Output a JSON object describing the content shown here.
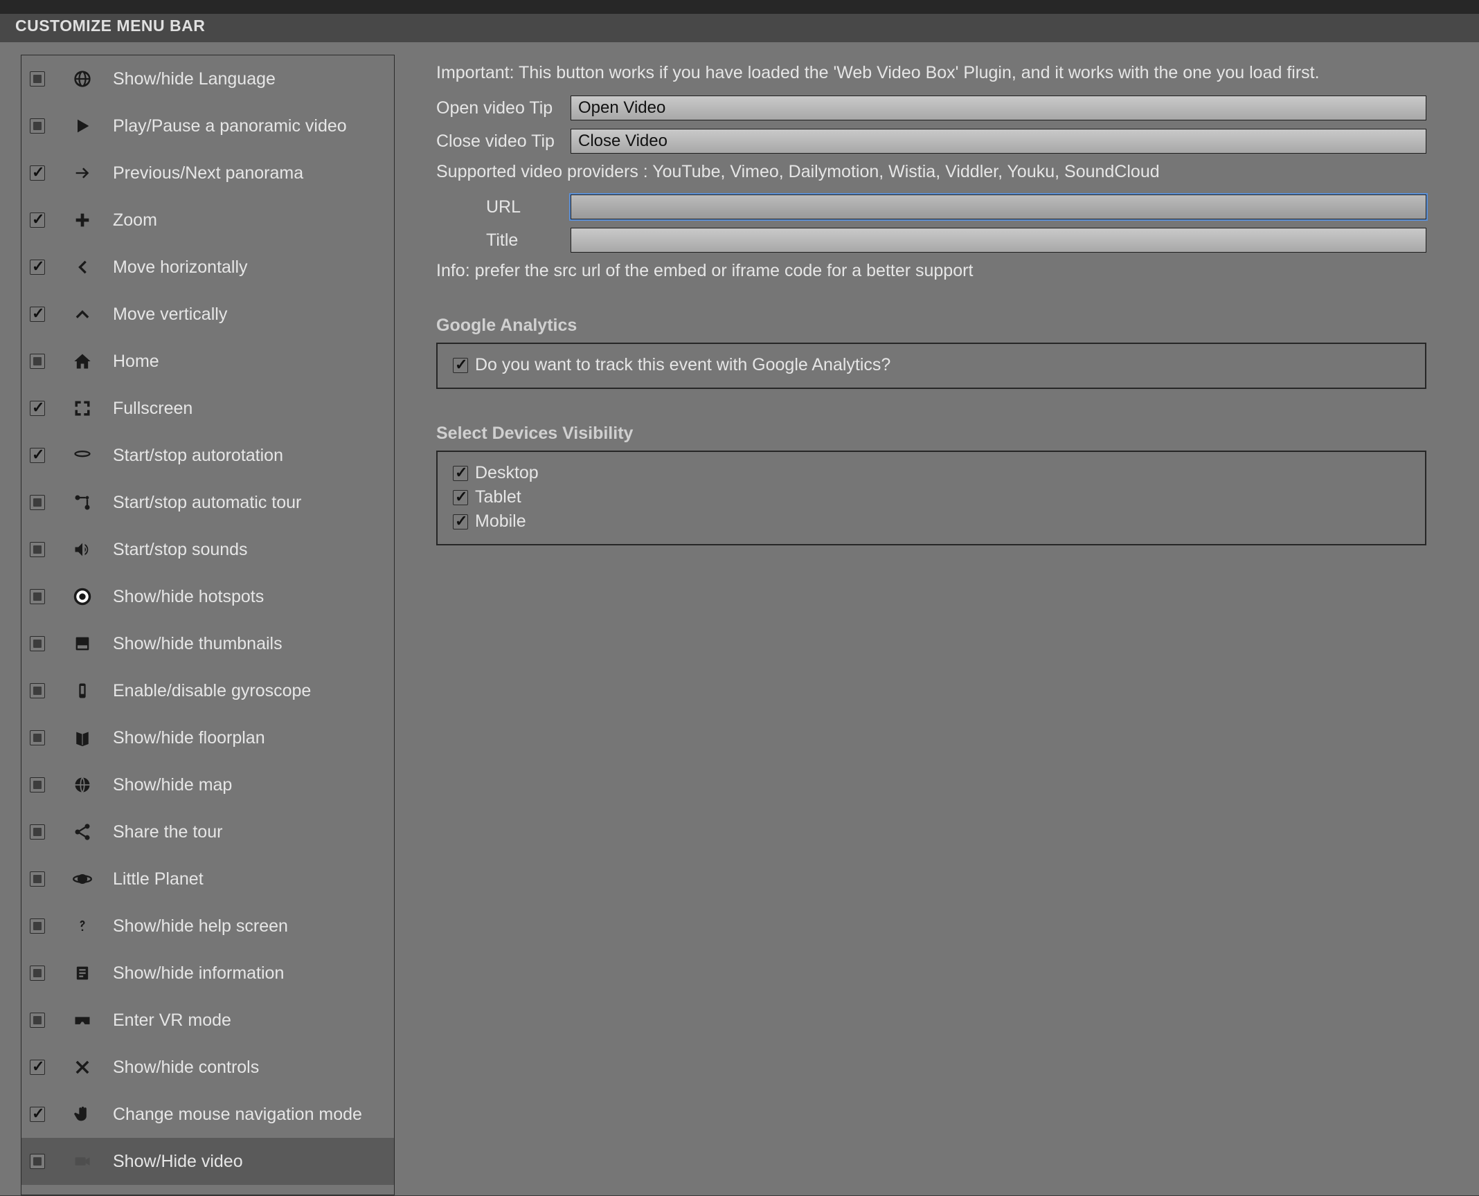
{
  "header": {
    "title": "CUSTOMIZE MENU BAR"
  },
  "sidebar": {
    "items": [
      {
        "checked": false,
        "icon": "globe",
        "label": "Show/hide Language"
      },
      {
        "checked": false,
        "icon": "play",
        "label": "Play/Pause a panoramic video"
      },
      {
        "checked": true,
        "icon": "arrow-right",
        "label": "Previous/Next panorama"
      },
      {
        "checked": true,
        "icon": "plus",
        "label": "Zoom"
      },
      {
        "checked": true,
        "icon": "chevron-left",
        "label": "Move horizontally"
      },
      {
        "checked": true,
        "icon": "chevron-up",
        "label": "Move vertically"
      },
      {
        "checked": false,
        "icon": "home",
        "label": "Home"
      },
      {
        "checked": true,
        "icon": "fullscreen",
        "label": "Fullscreen"
      },
      {
        "checked": true,
        "icon": "rotate",
        "label": "Start/stop autorotation"
      },
      {
        "checked": false,
        "icon": "route",
        "label": "Start/stop automatic tour"
      },
      {
        "checked": false,
        "icon": "sound",
        "label": "Start/stop sounds"
      },
      {
        "checked": false,
        "icon": "hotspot",
        "label": "Show/hide hotspots"
      },
      {
        "checked": false,
        "icon": "thumbnails",
        "label": "Show/hide thumbnails"
      },
      {
        "checked": false,
        "icon": "gyroscope",
        "label": "Enable/disable gyroscope"
      },
      {
        "checked": false,
        "icon": "floorplan",
        "label": "Show/hide floorplan"
      },
      {
        "checked": false,
        "icon": "map-globe",
        "label": "Show/hide map"
      },
      {
        "checked": false,
        "icon": "share",
        "label": "Share the tour"
      },
      {
        "checked": false,
        "icon": "planet",
        "label": "Little Planet"
      },
      {
        "checked": false,
        "icon": "help",
        "label": "Show/hide help screen"
      },
      {
        "checked": false,
        "icon": "info",
        "label": "Show/hide information"
      },
      {
        "checked": false,
        "icon": "vr",
        "label": "Enter VR mode"
      },
      {
        "checked": true,
        "icon": "close",
        "label": "Show/hide controls"
      },
      {
        "checked": true,
        "icon": "hand",
        "label": "Change mouse navigation mode"
      },
      {
        "checked": false,
        "icon": "video",
        "label": "Show/Hide video",
        "selected": true
      }
    ]
  },
  "main": {
    "important": "Important: This button works if you have loaded the 'Web Video Box' Plugin, and it works with the one you load first.",
    "open_tip_label": "Open video Tip",
    "open_tip_value": "Open Video",
    "close_tip_label": "Close video Tip",
    "close_tip_value": "Close Video",
    "providers": "Supported video providers : YouTube, Vimeo, Dailymotion, Wistia, Viddler, Youku, SoundCloud",
    "url_label": "URL",
    "url_value": "",
    "title_label": "Title",
    "title_value": "",
    "info": "Info: prefer the src url of the embed or iframe code for a better support",
    "analytics": {
      "heading": "Google Analytics",
      "track_label": "Do you want to track this event with Google Analytics?",
      "track_checked": true
    },
    "devices": {
      "heading": "Select Devices Visibility",
      "desktop_label": "Desktop",
      "desktop_checked": true,
      "tablet_label": "Tablet",
      "tablet_checked": true,
      "mobile_label": "Mobile",
      "mobile_checked": true
    }
  }
}
